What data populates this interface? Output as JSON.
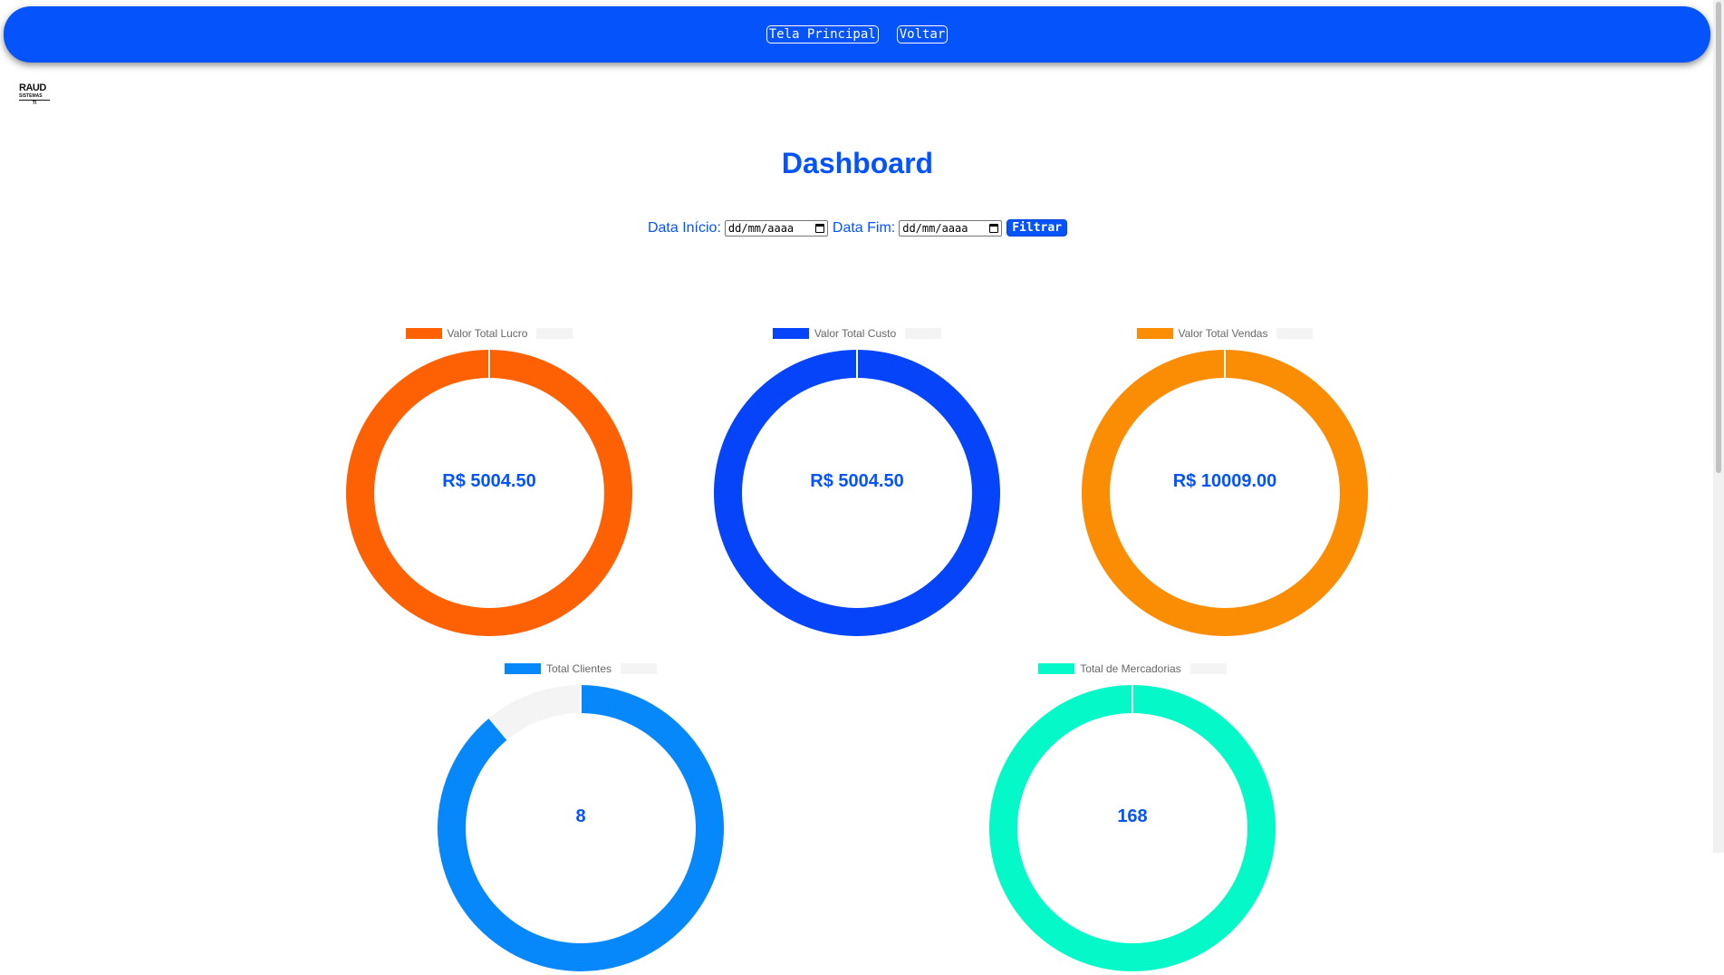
{
  "nav": {
    "home_label": "Tela Principal",
    "back_label": "Voltar",
    "bar_color": "#0554fb"
  },
  "logo": {
    "title": "RAUD",
    "subtitle": "SISTEMAS",
    "tag": "TI"
  },
  "page": {
    "title": "Dashboard"
  },
  "filters": {
    "start_label": "Data Início:",
    "end_label": "Data Fim:",
    "start_value": "dd/mm/aaaa",
    "end_value": "dd/mm/aaaa",
    "button_label": "Filtrar"
  },
  "chart_data": [
    {
      "type": "pie",
      "variant": "doughnut",
      "legend": [
        "Valor Total Lucro",
        ""
      ],
      "values": [
        100,
        0
      ],
      "colors": [
        "#fd6104",
        "#f4f4f4"
      ],
      "center_label": "R$ 5004.50"
    },
    {
      "type": "pie",
      "variant": "doughnut",
      "legend": [
        "Valor Total Custo",
        ""
      ],
      "values": [
        100,
        0
      ],
      "colors": [
        "#0544f9",
        "#f4f4f4"
      ],
      "center_label": "R$ 5004.50"
    },
    {
      "type": "pie",
      "variant": "doughnut",
      "legend": [
        "Valor Total Vendas",
        ""
      ],
      "values": [
        100,
        0
      ],
      "colors": [
        "#fa8d03",
        "#f4f4f4"
      ],
      "center_label": "R$ 10009.00"
    },
    {
      "type": "pie",
      "variant": "doughnut",
      "legend": [
        "Total Clientes",
        ""
      ],
      "values": [
        8,
        1
      ],
      "colors": [
        "#0688fb",
        "#f4f4f4"
      ],
      "center_label": "8"
    },
    {
      "type": "pie",
      "variant": "doughnut",
      "legend": [
        "Total de Mercadorias",
        ""
      ],
      "values": [
        168,
        0
      ],
      "colors": [
        "#05f9c8",
        "#f4f4f4"
      ],
      "center_label": "168"
    }
  ]
}
